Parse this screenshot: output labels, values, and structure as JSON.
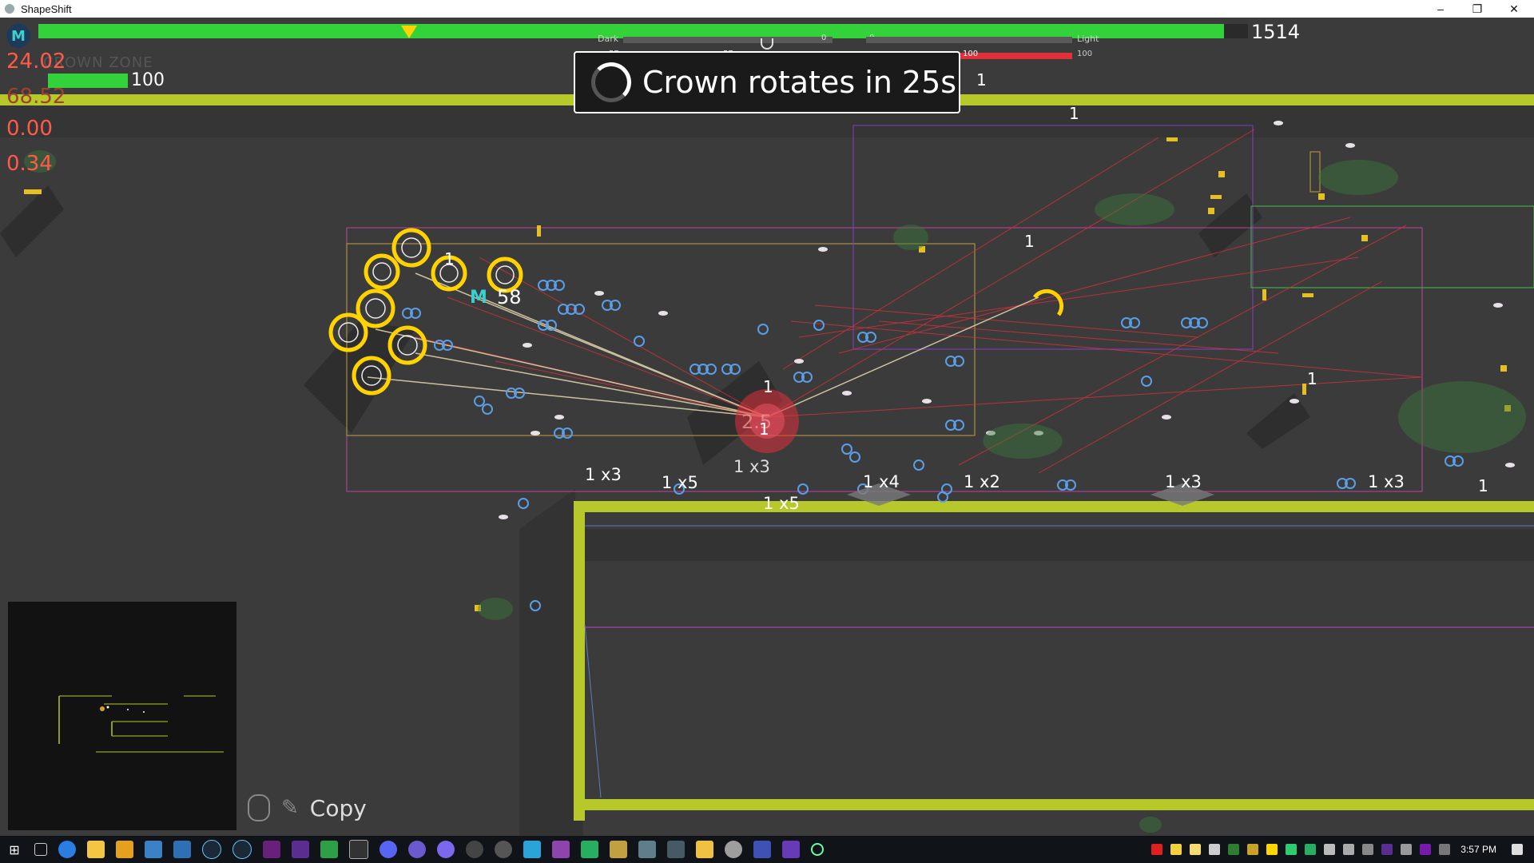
{
  "window": {
    "title": "ShapeShift",
    "minimize_icon": "minimize-icon",
    "restore_icon": "restore-icon",
    "close_icon": "close-icon"
  },
  "hud": {
    "player_badge": "M",
    "top_health_value": "1514",
    "top_health_fraction": 0.98,
    "zone_label": "CROWN ZONE",
    "small_health_value": "100",
    "stats": [
      "24.02",
      "68.52",
      "0.00",
      "0.34"
    ],
    "dark_label": "Dark",
    "light_label": "Light",
    "dark_value_left": "57",
    "dark_value_mid": "57",
    "dark_value_zero": "0",
    "light_value_zero": "0",
    "red_value_mid": "100",
    "red_value_right": "100",
    "crown_message": "Crown rotates in 25s",
    "crown_side_value": "1",
    "copy_label": "Copy"
  },
  "world": {
    "player_marker": "M",
    "player_count": "58",
    "center_value_top": "1",
    "center_value_mid": "1",
    "center_text": "2.5",
    "multipliers": [
      "1 x3",
      "1 x5",
      "1 x3",
      "1 x5",
      "1 x4",
      "1 x2",
      "1 x3",
      "1 x3"
    ],
    "ones": [
      "1",
      "1",
      "1",
      "1",
      "1"
    ]
  },
  "colors": {
    "health_green": "#34d23a",
    "wall_yellow": "#b7c82a",
    "enemy_red": "#e0303a",
    "hud_red": "#ff5a4a",
    "crown_yellow": "#ffd200"
  },
  "taskbar": {
    "time": "3:57 PM",
    "icons": [
      "windows-start-icon",
      "task-view-icon",
      "chrome-icon",
      "file-explorer-icon",
      "folder-icon",
      "notepad-icon",
      "editor-icon",
      "steam-icon",
      "steam-icon",
      "visual-studio-icon",
      "vs-icon",
      "h-app-icon",
      "terminal-icon",
      "discord-icon",
      "app-icon",
      "app-icon",
      "app-icon",
      "app-icon",
      "app-icon",
      "app-icon",
      "app-icon",
      "app-icon",
      "app-icon",
      "app-icon",
      "app-icon",
      "app-icon",
      "app-icon",
      "app-icon",
      "app-icon"
    ]
  }
}
